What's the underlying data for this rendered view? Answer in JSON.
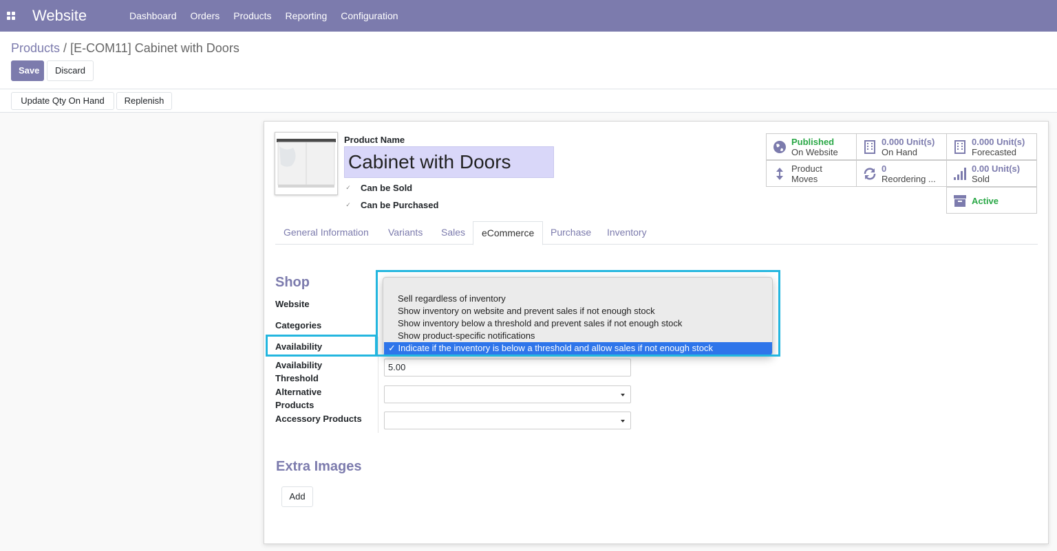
{
  "app": {
    "title": "Website"
  },
  "menu": [
    "Dashboard",
    "Orders",
    "Products",
    "Reporting",
    "Configuration"
  ],
  "breadcrumb": {
    "parent": "Products",
    "separator": "/",
    "current": "[E-COM11] Cabinet with Doors"
  },
  "actions": {
    "save": "Save",
    "discard": "Discard"
  },
  "statusbar": {
    "update_qty": "Update Qty On Hand",
    "replenish": "Replenish"
  },
  "product": {
    "name_label": "Product Name",
    "name": "Cabinet with Doors",
    "can_be_sold": "Can be Sold",
    "can_be_purchased": "Can be Purchased",
    "check_glyph": "✓"
  },
  "smart_buttons": {
    "published": {
      "value": "Published",
      "label": "On Website",
      "icon": "globe-icon"
    },
    "on_hand": {
      "value": "0.000",
      "unit": "Unit(s)",
      "label": "On Hand",
      "icon": "building-icon"
    },
    "forecasted": {
      "value": "0.000",
      "unit": "Unit(s)",
      "label": "Forecasted",
      "icon": "building-icon"
    },
    "moves": {
      "line1": "Product",
      "line2": "Moves",
      "icon": "arrows-v-icon"
    },
    "reordering": {
      "value": "0",
      "label": "Reordering ...",
      "icon": "refresh-icon"
    },
    "sold": {
      "value": "0.00",
      "unit": "Unit(s)",
      "label": "Sold",
      "icon": "signal-icon"
    },
    "active": {
      "label": "Active",
      "icon": "archive-icon"
    }
  },
  "tabs": [
    "General Information",
    "Variants",
    "Sales",
    "eCommerce",
    "Purchase",
    "Inventory"
  ],
  "active_tab": "eCommerce",
  "shop": {
    "title": "Shop",
    "website_label": "Website",
    "categories_label": "Categories",
    "availability_label": "Availability",
    "threshold_label_1": "Availability",
    "threshold_label_2": "Threshold",
    "threshold_value": "5.00",
    "alt_label_1": "Alternative",
    "alt_label_2": "Products",
    "accessory_label": "Accessory Products"
  },
  "availability_options": [
    "Sell regardless of inventory",
    "Show inventory on website and prevent sales if not enough stock",
    "Show inventory below a threshold and prevent sales if not enough stock",
    "Show product-specific notifications",
    "Indicate if the inventory is below a threshold and allow sales if not enough stock"
  ],
  "selected_option_prefix": "✓ ",
  "extra_images": {
    "title": "Extra Images",
    "add": "Add"
  },
  "colors": {
    "brand": "#7c7bad",
    "highlight": "#23b6df",
    "selection": "#2e75ea",
    "success": "#28a745"
  }
}
